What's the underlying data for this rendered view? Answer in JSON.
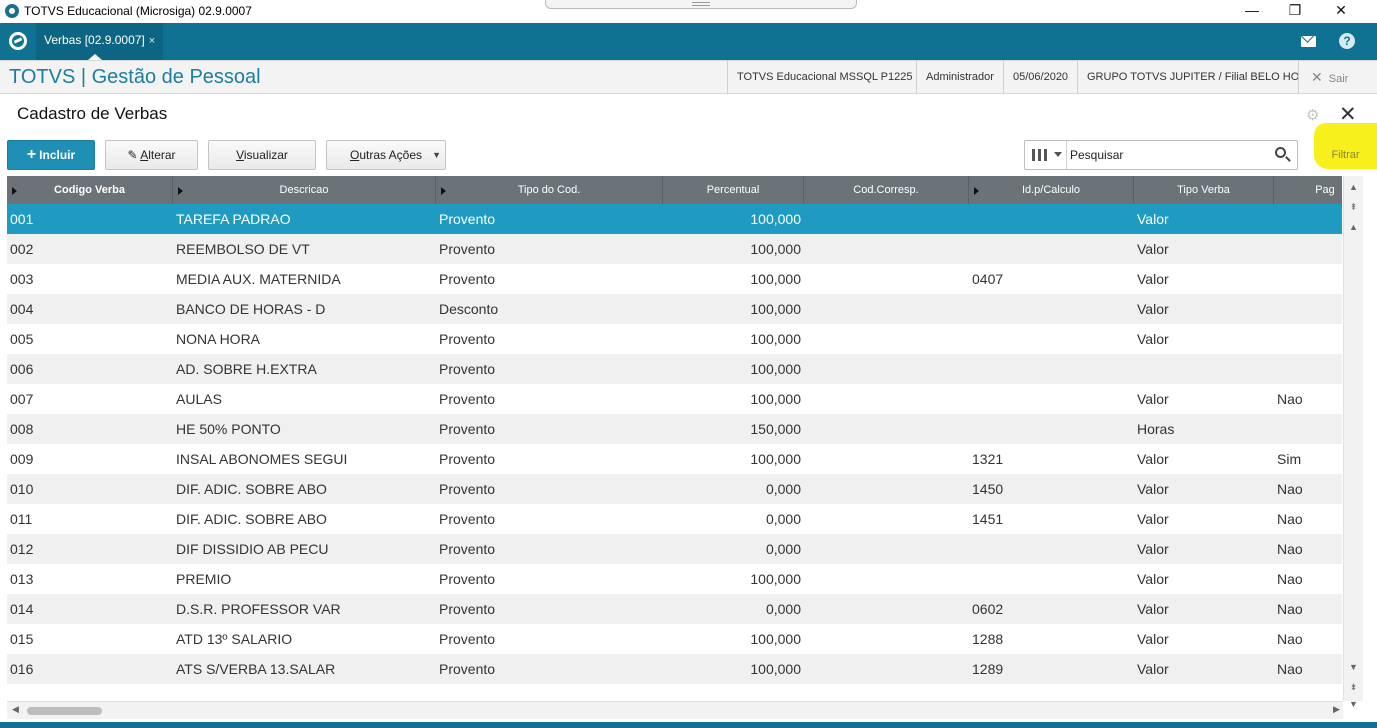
{
  "window": {
    "title": "TOTVS Educacional (Microsiga) 02.9.0007",
    "minimize": "—",
    "restore": "❐",
    "close": "✕"
  },
  "tabbar": {
    "tab_label": "Verbas [02.9.0007]",
    "tab_close": "×",
    "help": "?"
  },
  "module": {
    "title": "TOTVS | Gestão de Pessoal",
    "environment": "TOTVS Educacional MSSQL P1225",
    "user": "Administrador",
    "date": "05/06/2020",
    "company": "GRUPO TOTVS JUPITER / Filial BELO HOR",
    "exit_label": "Sair"
  },
  "page": {
    "title": "Cadastro de Verbas",
    "close": "✕"
  },
  "toolbar": {
    "incluir": "Incluir",
    "alterar_prefix": "A",
    "alterar_rest": "lterar",
    "visualizar_first": "V",
    "visualizar_rest": "isualizar",
    "outras_first": "O",
    "outras_rest": "utras Ações",
    "search_placeholder": "Pesquisar",
    "filtrar": "Filtrar"
  },
  "grid": {
    "columns": [
      "Codigo Verba",
      "Descricao",
      "Tipo do Cod.",
      "Percentual",
      "Cod.Corresp.",
      "Id.p/Calculo",
      "Tipo Verba",
      "Pag"
    ],
    "rows": [
      [
        "001",
        "TAREFA PADRAO",
        "Provento",
        "100,000",
        "",
        "",
        "Valor",
        ""
      ],
      [
        "002",
        "REEMBOLSO DE VT",
        "Provento",
        "100,000",
        "",
        "",
        "Valor",
        ""
      ],
      [
        "003",
        "MEDIA AUX. MATERNIDA",
        "Provento",
        "100,000",
        "",
        "0407",
        "Valor",
        ""
      ],
      [
        "004",
        "BANCO DE HORAS - D",
        "Desconto",
        "100,000",
        "",
        "",
        "Valor",
        ""
      ],
      [
        "005",
        "NONA HORA",
        "Provento",
        "100,000",
        "",
        "",
        "Valor",
        ""
      ],
      [
        "006",
        "AD. SOBRE H.EXTRA",
        "Provento",
        "100,000",
        "",
        "",
        "",
        ""
      ],
      [
        "007",
        "AULAS",
        "Provento",
        "100,000",
        "",
        "",
        "Valor",
        "Nao"
      ],
      [
        "008",
        "HE 50% PONTO",
        "Provento",
        "150,000",
        "",
        "",
        "Horas",
        ""
      ],
      [
        "009",
        "INSAL ABONOMES SEGUI",
        "Provento",
        "100,000",
        "",
        "1321",
        "Valor",
        "Sim"
      ],
      [
        "010",
        "DIF. ADIC. SOBRE ABO",
        "Provento",
        "0,000",
        "",
        "1450",
        "Valor",
        "Nao"
      ],
      [
        "011",
        "DIF. ADIC. SOBRE ABO",
        "Provento",
        "0,000",
        "",
        "1451",
        "Valor",
        "Nao"
      ],
      [
        "012",
        "DIF DISSIDIO AB PECU",
        "Provento",
        "0,000",
        "",
        "",
        "Valor",
        "Nao"
      ],
      [
        "013",
        "PREMIO",
        "Provento",
        "100,000",
        "",
        "",
        "Valor",
        "Nao"
      ],
      [
        "014",
        "D.S.R. PROFESSOR VAR",
        "Provento",
        "0,000",
        "",
        "0602",
        "Valor",
        "Nao"
      ],
      [
        "015",
        "ATD 13º SALARIO",
        "Provento",
        "100,000",
        "",
        "1288",
        "Valor",
        "Nao"
      ],
      [
        "016",
        "ATS S/VERBA 13.SALAR",
        "Provento",
        "100,000",
        "",
        "1289",
        "Valor",
        "Nao"
      ]
    ]
  },
  "colors": {
    "teal": "#0f7293",
    "selected_row": "#1f9bc2",
    "header": "#6c7378",
    "highlight": "#f7f01c"
  }
}
